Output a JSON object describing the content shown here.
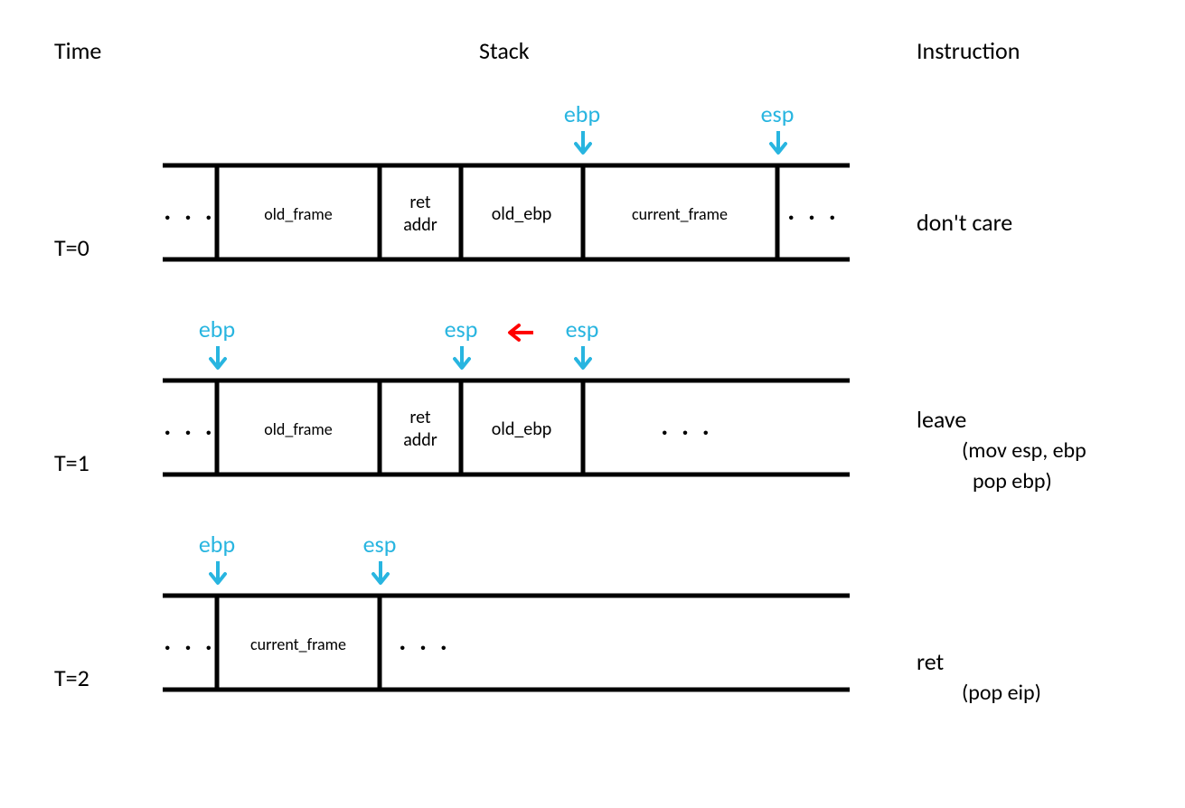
{
  "headers": {
    "time": "Time",
    "stack": "Stack",
    "instruction": "Instruction"
  },
  "pointers": {
    "ebp": "ebp",
    "esp": "esp"
  },
  "cells": {
    "old_frame": "old_frame",
    "ret_addr_l1": "ret",
    "ret_addr_l2": "addr",
    "old_ebp": "old_ebp",
    "current_frame": "current_frame",
    "ellipsis": ". . ."
  },
  "rows": [
    {
      "time": "T=0",
      "instruction_main": "don't care",
      "instruction_sub1": "",
      "instruction_sub2": ""
    },
    {
      "time": "T=1",
      "instruction_main": "leave",
      "instruction_sub1": "(mov esp, ebp",
      "instruction_sub2": " pop ebp)"
    },
    {
      "time": "T=2",
      "instruction_main": "ret",
      "instruction_sub1": "(pop eip)",
      "instruction_sub2": ""
    }
  ]
}
